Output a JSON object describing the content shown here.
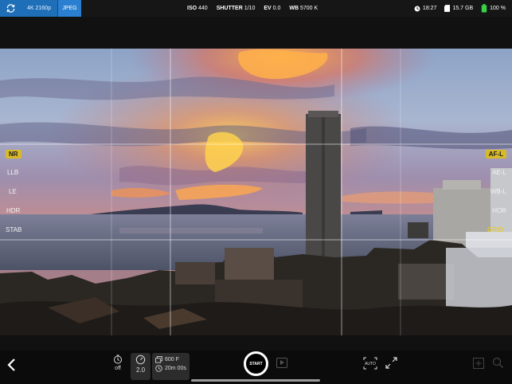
{
  "topbar": {
    "resolution": "4K 2160p",
    "format": "JPEG",
    "iso": {
      "label": "ISO",
      "value": "440"
    },
    "shutter": {
      "label": "SHUTTER",
      "value": "1/10"
    },
    "ev": {
      "label": "EV",
      "value": "0.0"
    },
    "wb": {
      "label": "WB",
      "value": "5700 K"
    },
    "time": "18:27",
    "storage": "15.7 GB",
    "battery": "100 %",
    "battery_level": 1.0
  },
  "left_menu": {
    "nr": "NR",
    "llb": "LLB",
    "le": "LE",
    "hdr": "HDR",
    "stab": "STAB"
  },
  "right_menu": {
    "afl": "AF-L",
    "ael": "AE-L",
    "wbl": "WB-L",
    "hor": "HOR",
    "grid": "GRID"
  },
  "bottombar": {
    "timer_value": "off",
    "interval_value": "2.0",
    "frames_value": "600 F",
    "duration_value": "20m 00s",
    "start_label": "START",
    "auto_label": "AUTO"
  },
  "colors": {
    "accent_blue": "#1e6fb8",
    "active_yellow": "#d7b92a",
    "battery_green": "#37d14a"
  },
  "icons": [
    "rotate-icon",
    "clock-icon",
    "storage-icon",
    "battery-icon",
    "back-chevron-icon",
    "timer-icon",
    "interval-icon",
    "frames-icon",
    "duration-icon",
    "play-icon",
    "auto-focus-icon",
    "expand-icon",
    "add-icon",
    "search-icon"
  ]
}
